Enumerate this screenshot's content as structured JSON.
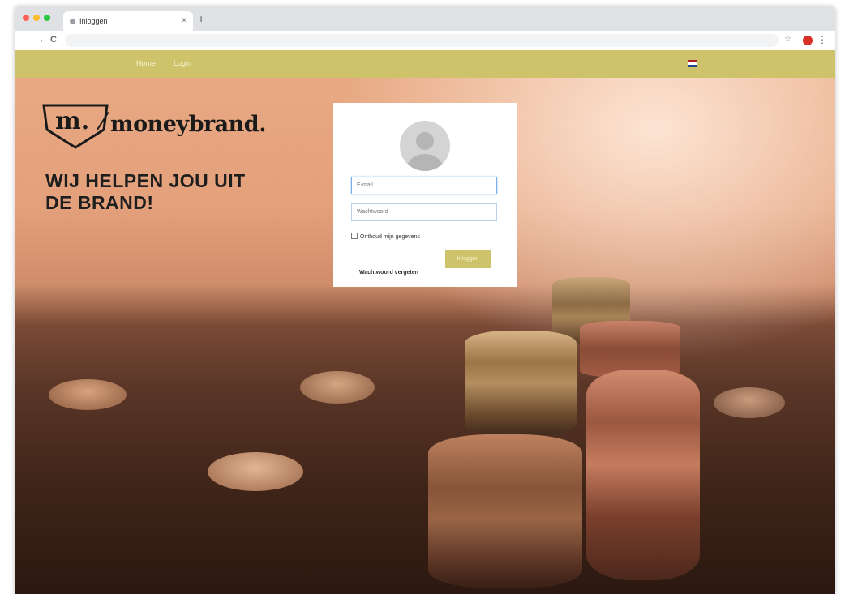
{
  "browser": {
    "tab_title": "Inloggen",
    "tab_close": "×",
    "new_tab": "+",
    "nav_back": "←",
    "nav_forward": "→",
    "reload": "C",
    "bookmark_star": "☆",
    "menu": "⋮",
    "profile_color": "#d93025"
  },
  "site_nav": {
    "background": "#cec36a",
    "links": [
      "Home",
      "Login"
    ],
    "language": "NL"
  },
  "brand": {
    "logo_mark": "m.",
    "name": "moneybrand.",
    "slogan_line1": "WIJ HELPEN JOU UIT",
    "slogan_line2": "DE BRAND!"
  },
  "login": {
    "email_placeholder": "E-mail",
    "password_placeholder": "Wachtwoord",
    "remember_label": "Onthoud mijn gegevens",
    "submit_label": "Inloggen",
    "forgot_label": "Wachtwoord vergeten",
    "accent": "#cec36a"
  }
}
